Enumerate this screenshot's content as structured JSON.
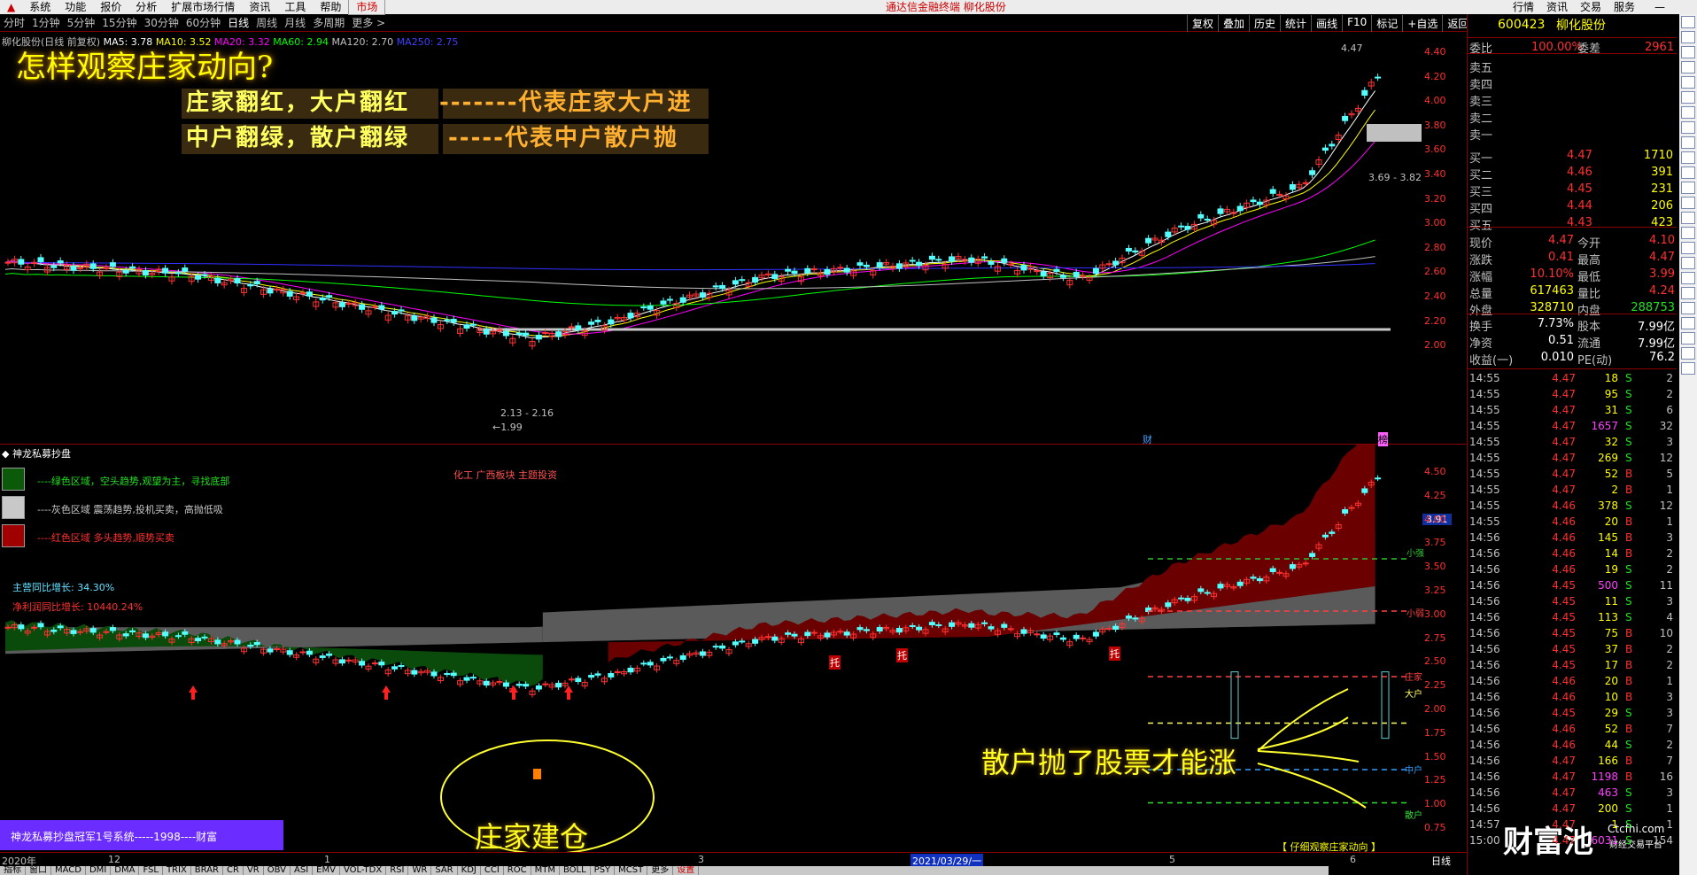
{
  "menubar": {
    "items": [
      "系统",
      "功能",
      "报价",
      "分析",
      "扩展市场行情",
      "资讯",
      "工具",
      "帮助"
    ],
    "active": "市场",
    "title": "通达信金融终端  柳化股份",
    "right": [
      "行情",
      "资讯",
      "交易",
      "服务"
    ]
  },
  "periods": [
    "分时",
    "1分钟",
    "5分钟",
    "15分钟",
    "30分钟",
    "60分钟",
    "日线",
    "周线",
    "月线",
    "多周期",
    "更多 >"
  ],
  "active_period": "日线",
  "toolbar": [
    "复权",
    "叠加",
    "历史",
    "统计",
    "画线",
    "F10",
    "标记",
    "+自选",
    "返回"
  ],
  "ma_legend": {
    "stock": "柳化股份(日线 前复权)",
    "ma5": "MA5: 3.78",
    "ma10": "MA10: 3.52",
    "ma20": "MA20: 3.32",
    "ma60": "MA60: 2.94",
    "ma120": "MA120: 2.70",
    "ma250": "MA250: 2.75"
  },
  "overlay": {
    "headline": "怎样观察庄家动向?",
    "line1_a": "庄家翻红，大户翻红",
    "line1_b": "-------代表庄家大户进",
    "line2_a": "中户翻绿，散户翻绿",
    "line2_b": "-----代表中户散户抛",
    "jiancang": "庄家建仓",
    "sanhu": "散户抛了股票才能涨"
  },
  "main_y": [
    "4.40",
    "4.20",
    "4.00",
    "3.80",
    "3.60",
    "3.40",
    "3.20",
    "3.00",
    "2.80",
    "2.60",
    "2.40",
    "2.20",
    "2.00"
  ],
  "main_labels": {
    "high": "4.47",
    "range_top": "3.69 - 3.82",
    "range_low": "2.13 - 2.16",
    "low": "←1.99",
    "cai": "财",
    "long": "榜"
  },
  "indicator": {
    "name": "神龙私募抄盘",
    "green": "----绿色区域，空头趋势,观望为主，寻找底部",
    "gray": "----灰色区域 震荡趋势,投机买卖，高抛低吸",
    "red": "----红色区域 多头趋势,顺势买卖",
    "sector": "化工 广西板块 主题投资",
    "revenue": "主营同比增长: 34.30%",
    "profit": "净利润同比增长: 10440.24%",
    "tuo": "托",
    "banner": "神龙私募抄盘冠军1号系统-----1998----财富",
    "hint": "【 仔细观察庄家动向 】",
    "cur": "3.91",
    "y": [
      "4.50",
      "4.25",
      "4.00",
      "3.75",
      "3.50",
      "3.25",
      "3.00",
      "2.75",
      "2.50",
      "2.25",
      "2.00",
      "1.75",
      "1.50",
      "1.25",
      "1.00",
      "0.75"
    ],
    "right_labels": [
      "小强",
      "小弱",
      "庄家",
      "大户",
      "中户",
      "散户"
    ]
  },
  "xaxis": {
    "labels": [
      "2020年",
      "12",
      "1",
      "3",
      "5",
      "6"
    ],
    "cursor": "2021/03/29/一",
    "right": "日线"
  },
  "bottom_tabs": [
    "指标",
    "窗口",
    "MACD",
    "DMI",
    "DMA",
    "FSL",
    "TRIX",
    "BRAR",
    "CR",
    "VR",
    "OBV",
    "ASI",
    "EMV",
    "VOL-TDX",
    "RSI",
    "WR",
    "SAR",
    "KDJ",
    "CCI",
    "ROC",
    "MTM",
    "BOLL",
    "PSY",
    "MCST",
    "更多",
    "设置"
  ],
  "side": {
    "code": "600423",
    "name": "柳化股份",
    "weibi_l": "委比",
    "weibi": "100.00%",
    "weicha_l": "委差",
    "weicha": "2961",
    "sell": [
      "卖五",
      "卖四",
      "卖三",
      "卖二",
      "卖一"
    ],
    "buy": [
      [
        "买一",
        "4.47",
        "1710"
      ],
      [
        "买二",
        "4.46",
        "391"
      ],
      [
        "买三",
        "4.45",
        "231"
      ],
      [
        "买四",
        "4.44",
        "206"
      ],
      [
        "买五",
        "4.43",
        "423"
      ]
    ],
    "quote": [
      [
        "现价",
        "4.47",
        "今开",
        "4.10"
      ],
      [
        "涨跌",
        "0.41",
        "最高",
        "4.47"
      ],
      [
        "涨幅",
        "10.10%",
        "最低",
        "3.99"
      ],
      [
        "总量",
        "617463",
        "量比",
        "4.24"
      ],
      [
        "外盘",
        "328710",
        "内盘",
        "288753"
      ]
    ],
    "stats": [
      [
        "换手",
        "7.73%",
        "股本",
        "7.99亿"
      ],
      [
        "净资",
        "0.51",
        "流通",
        "7.99亿"
      ],
      [
        "收益(一)",
        "0.010",
        "PE(动)",
        "76.2"
      ]
    ],
    "ticks": [
      [
        "14:55",
        "4.47",
        "18",
        "S",
        "2"
      ],
      [
        "14:55",
        "4.47",
        "95",
        "S",
        "2"
      ],
      [
        "14:55",
        "4.47",
        "31",
        "S",
        "6"
      ],
      [
        "14:55",
        "4.47",
        "1657",
        "S",
        "32"
      ],
      [
        "14:55",
        "4.47",
        "32",
        "S",
        "3"
      ],
      [
        "14:55",
        "4.47",
        "269",
        "S",
        "12"
      ],
      [
        "14:55",
        "4.47",
        "52",
        "B",
        "5"
      ],
      [
        "14:55",
        "4.47",
        "2",
        "B",
        "1"
      ],
      [
        "14:55",
        "4.46",
        "378",
        "S",
        "12"
      ],
      [
        "14:55",
        "4.46",
        "20",
        "B",
        "1"
      ],
      [
        "14:56",
        "4.46",
        "145",
        "B",
        "3"
      ],
      [
        "14:56",
        "4.46",
        "14",
        "B",
        "2"
      ],
      [
        "14:56",
        "4.46",
        "19",
        "S",
        "2"
      ],
      [
        "14:56",
        "4.45",
        "500",
        "S",
        "11"
      ],
      [
        "14:56",
        "4.45",
        "11",
        "S",
        "3"
      ],
      [
        "14:56",
        "4.45",
        "113",
        "S",
        "4"
      ],
      [
        "14:56",
        "4.45",
        "75",
        "B",
        "10"
      ],
      [
        "14:56",
        "4.45",
        "37",
        "B",
        "2"
      ],
      [
        "14:56",
        "4.45",
        "17",
        "B",
        "2"
      ],
      [
        "14:56",
        "4.46",
        "20",
        "B",
        "1"
      ],
      [
        "14:56",
        "4.46",
        "10",
        "B",
        "3"
      ],
      [
        "14:56",
        "4.45",
        "29",
        "S",
        "3"
      ],
      [
        "14:56",
        "4.46",
        "52",
        "B",
        "7"
      ],
      [
        "14:56",
        "4.46",
        "44",
        "S",
        "2"
      ],
      [
        "14:56",
        "4.47",
        "166",
        "B",
        "7"
      ],
      [
        "14:56",
        "4.47",
        "1198",
        "B",
        "16"
      ],
      [
        "14:56",
        "4.47",
        "463",
        "S",
        "3"
      ],
      [
        "14:56",
        "4.47",
        "200",
        "S",
        "1"
      ],
      [
        "14:57",
        "4.47",
        "1",
        "S",
        "1"
      ],
      [
        "15:00",
        "4.47",
        "6031",
        "S",
        "154"
      ]
    ]
  },
  "colors": {
    "up": "#ff3232",
    "down": "#54ffff",
    "ma5": "#ffffff",
    "ma10": "#ffff00",
    "ma20": "#ff00ff",
    "ma60": "#00ff00",
    "ma120": "#c0c0c0",
    "ma250": "#3030ff"
  },
  "watermark": {
    "brand": "财富池",
    "site": "Ctcfhi.com",
    "sub": "财经交易平台"
  }
}
